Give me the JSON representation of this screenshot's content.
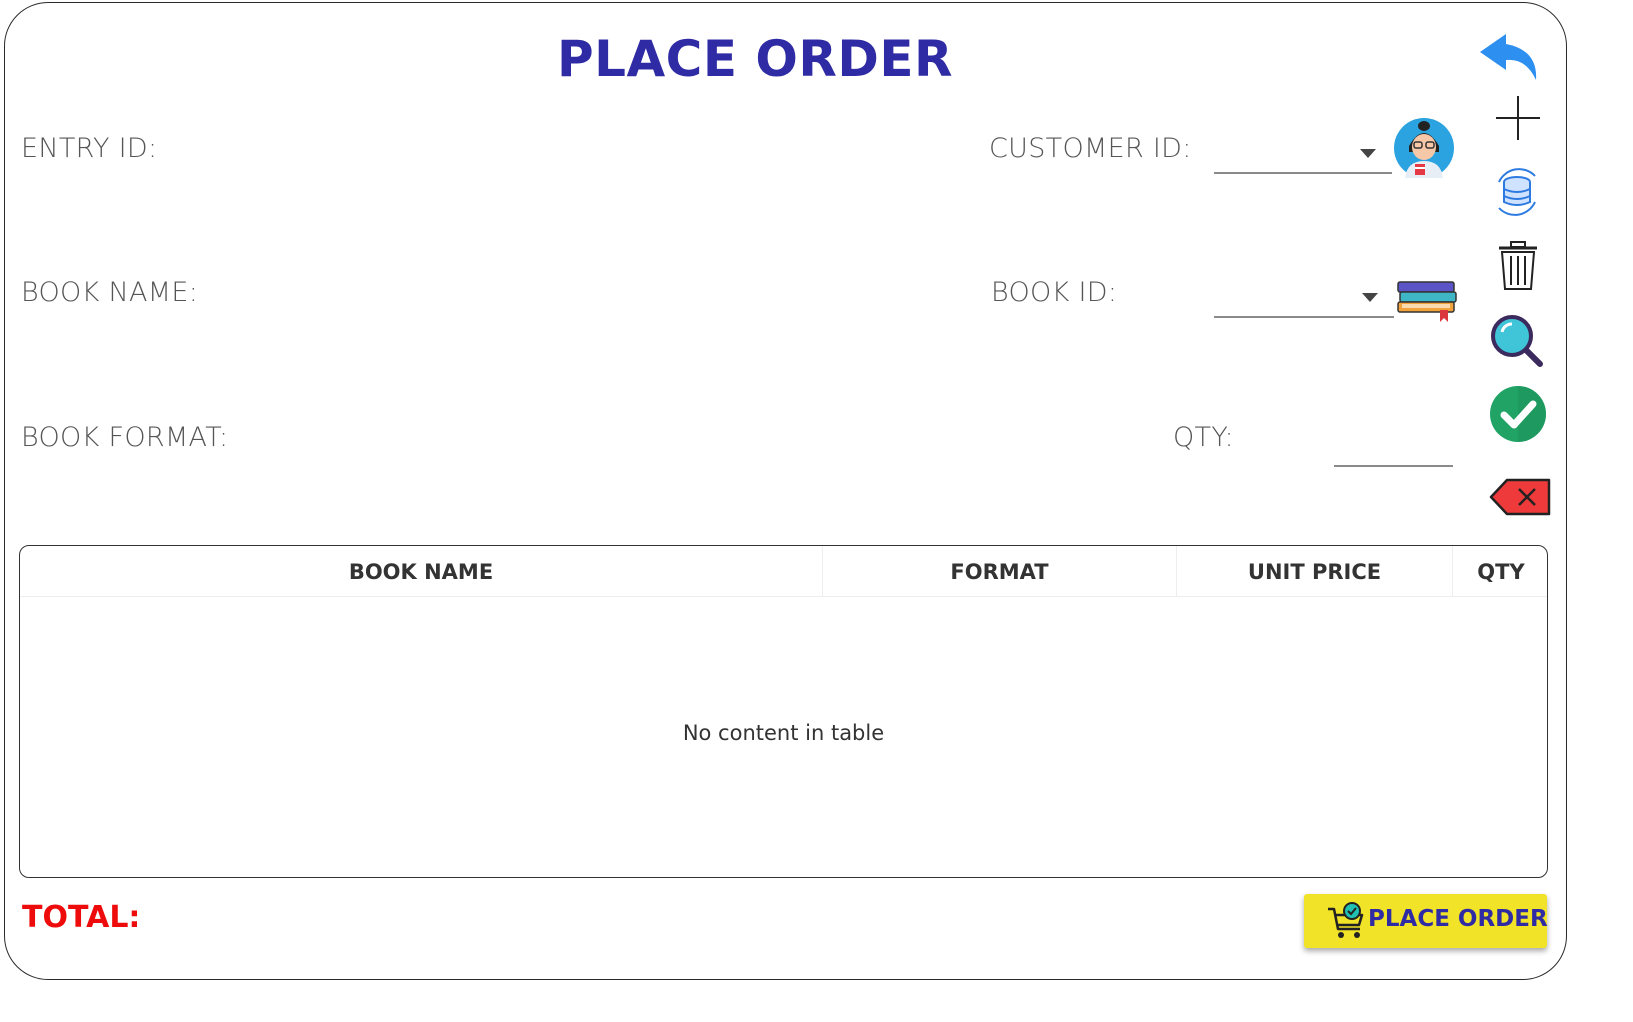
{
  "title": "PLACE ORDER",
  "form": {
    "entry_id_label": "ENTRY ID:",
    "customer_id_label": "CUSTOMER ID:",
    "book_name_label": "BOOK NAME:",
    "book_id_label": "BOOK ID:",
    "book_format_label": "BOOK FORMAT:",
    "qty_label": "QTY:"
  },
  "toolbar": {
    "icons": [
      "back-arrow-icon",
      "plus-icon",
      "database-refresh-icon",
      "trash-icon",
      "search-icon",
      "check-icon",
      "clear-icon"
    ]
  },
  "table": {
    "columns": [
      "BOOK NAME",
      "FORMAT",
      "UNIT PRICE",
      "QTY"
    ],
    "rows": [],
    "placeholder": "No content in table"
  },
  "footer": {
    "total_label": "TOTAL:",
    "place_order_label": "PLACE ORDER"
  },
  "colors": {
    "title": "#2f2ba4",
    "total": "#ee0b0b",
    "button_bg": "#f1e328",
    "accent_blue": "#2d8ff0",
    "check_green": "#21a366"
  }
}
